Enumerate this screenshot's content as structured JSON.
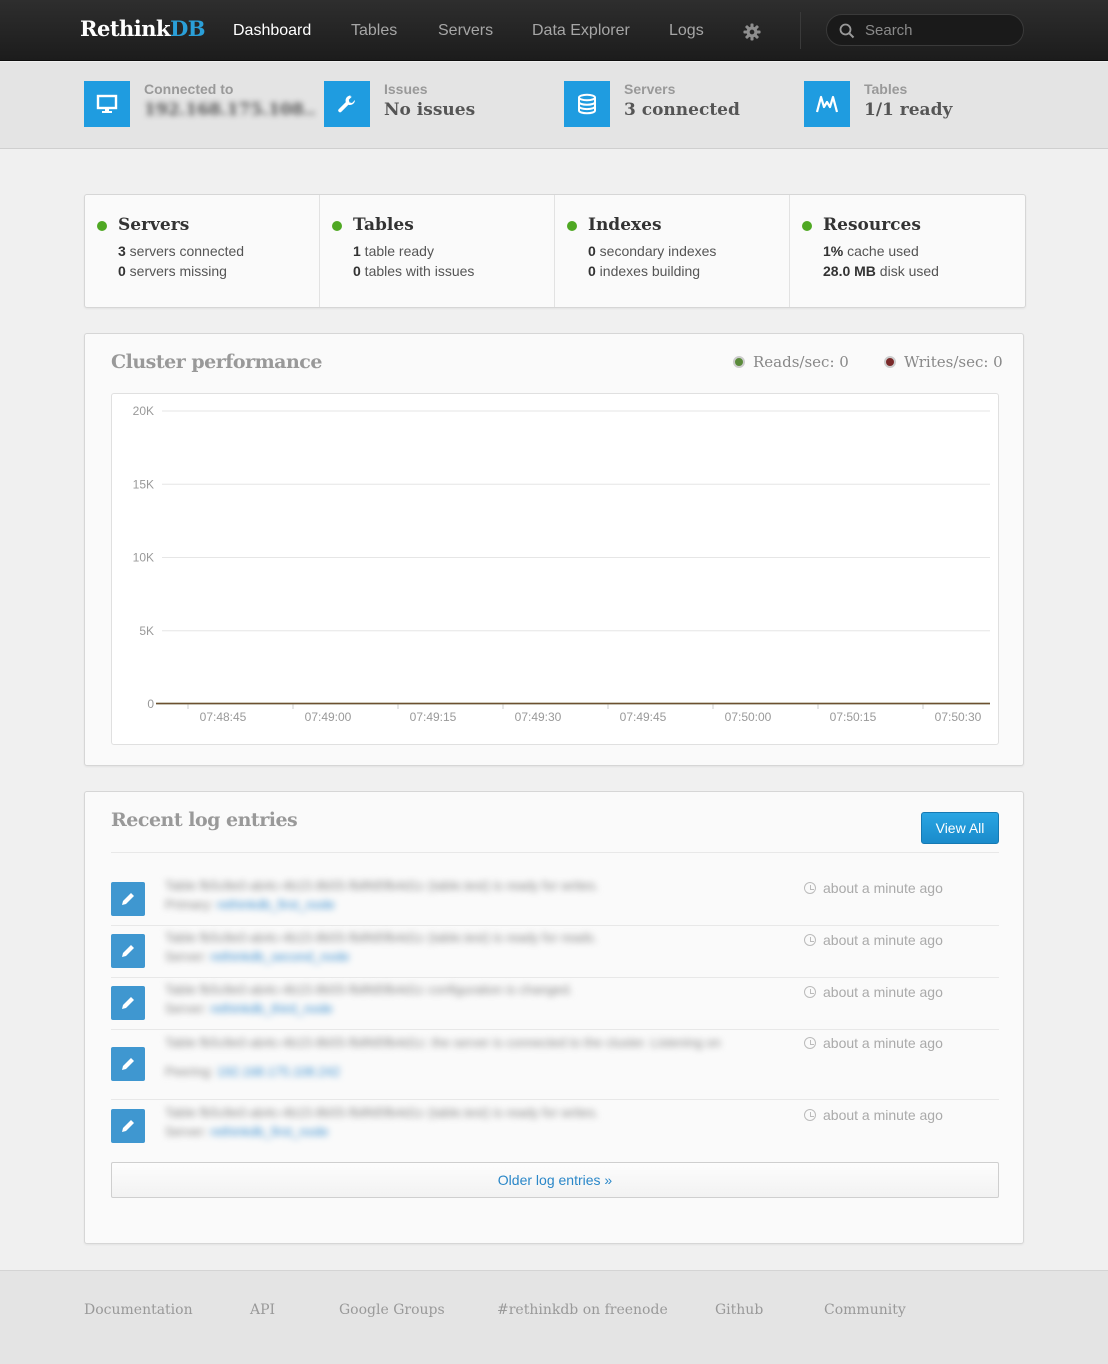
{
  "nav": {
    "brand_main": "Rethink",
    "brand_accent": "DB",
    "links": [
      "Dashboard",
      "Tables",
      "Servers",
      "Data Explorer",
      "Logs"
    ],
    "active": "Dashboard",
    "search_placeholder": "Search"
  },
  "statusbar": {
    "connected": {
      "label": "Connected to",
      "value": "192.168.175.108..",
      "icon": "monitor-icon"
    },
    "issues": {
      "label": "Issues",
      "value": "No issues",
      "icon": "wrench-icon"
    },
    "servers": {
      "label": "Servers",
      "value": "3 connected",
      "icon": "database-icon"
    },
    "tables": {
      "label": "Tables",
      "value": "1/1 ready",
      "icon": "chart-icon"
    }
  },
  "summary": {
    "servers": {
      "title": "Servers",
      "l1_num": "3",
      "l1_text": " servers connected",
      "l2_num": "0",
      "l2_text": " servers missing"
    },
    "tables": {
      "title": "Tables",
      "l1_num": "1",
      "l1_text": " table ready",
      "l2_num": "0",
      "l2_text": " tables with issues"
    },
    "indexes": {
      "title": "Indexes",
      "l1_num": "0",
      "l1_text": " secondary indexes",
      "l2_num": "0",
      "l2_text": " indexes building"
    },
    "resources": {
      "title": "Resources",
      "l1_num": "1%",
      "l1_text": " cache used",
      "l2_num": "28.0 MB",
      "l2_text": " disk used"
    },
    "status_color": "#4fa823"
  },
  "performance": {
    "title": "Cluster performance",
    "reads_label": "Reads/sec: 0",
    "writes_label": "Writes/sec: 0",
    "reads_color": "#5a8a3a",
    "writes_color": "#7a2a2a"
  },
  "chart_data": {
    "type": "line",
    "x": [
      "07:48:45",
      "07:49:00",
      "07:49:15",
      "07:49:30",
      "07:49:45",
      "07:50:00",
      "07:50:15",
      "07:50:30"
    ],
    "yticks": [
      "0",
      "5K",
      "10K",
      "15K",
      "20K"
    ],
    "ylim": [
      0,
      20000
    ],
    "series": [
      {
        "name": "Reads/sec",
        "values": [
          0,
          0,
          0,
          0,
          0,
          0,
          0,
          0
        ]
      },
      {
        "name": "Writes/sec",
        "values": [
          0,
          0,
          0,
          0,
          0,
          0,
          0,
          0
        ]
      }
    ],
    "grid": true
  },
  "logs": {
    "title": "Recent log entries",
    "view_all": "View All",
    "entries": [
      {
        "text": "Table fb5c8e0-ab4c-4b15-8b55-fb8fd5fb4d1c (table.test) is ready for writes.",
        "sub_prefix": "Primary: ",
        "sub_link": "rethinkdb_first_node",
        "time": "about a minute ago"
      },
      {
        "text": "Table fb5c8e0-ab4c-4b15-8b55-fb8fd5fb4d1c (table.test) is ready for reads.",
        "sub_prefix": "Server: ",
        "sub_link": "rethinkdb_second_node",
        "time": "about a minute ago"
      },
      {
        "text": "Table fb5c8e0-ab4c-4b15-8b55-fb8fd5fb4d1c configuration is changed.",
        "sub_prefix": "Server: ",
        "sub_link": "rethinkdb_third_node",
        "time": "about a minute ago"
      },
      {
        "text": "Table fb5c8e0-ab4c-4b15-8b55-fb8fd5fb4d1c: the server is connected to the cluster. Listening on",
        "sub_prefix": "Peering: ",
        "sub_link": "192.168.175.108.242",
        "time": "about a minute ago"
      },
      {
        "text": "Table fb5c8e0-ab4c-4b15-8b55-fb8fd5fb4d1c (table.test) is ready for writes.",
        "sub_prefix": "Server: ",
        "sub_link": "rethinkdb_first_node",
        "time": "about a minute ago"
      }
    ],
    "older": "Older log entries »"
  },
  "footer": [
    "Documentation",
    "API",
    "Google Groups",
    "#rethinkdb on freenode",
    "Github",
    "Community"
  ]
}
